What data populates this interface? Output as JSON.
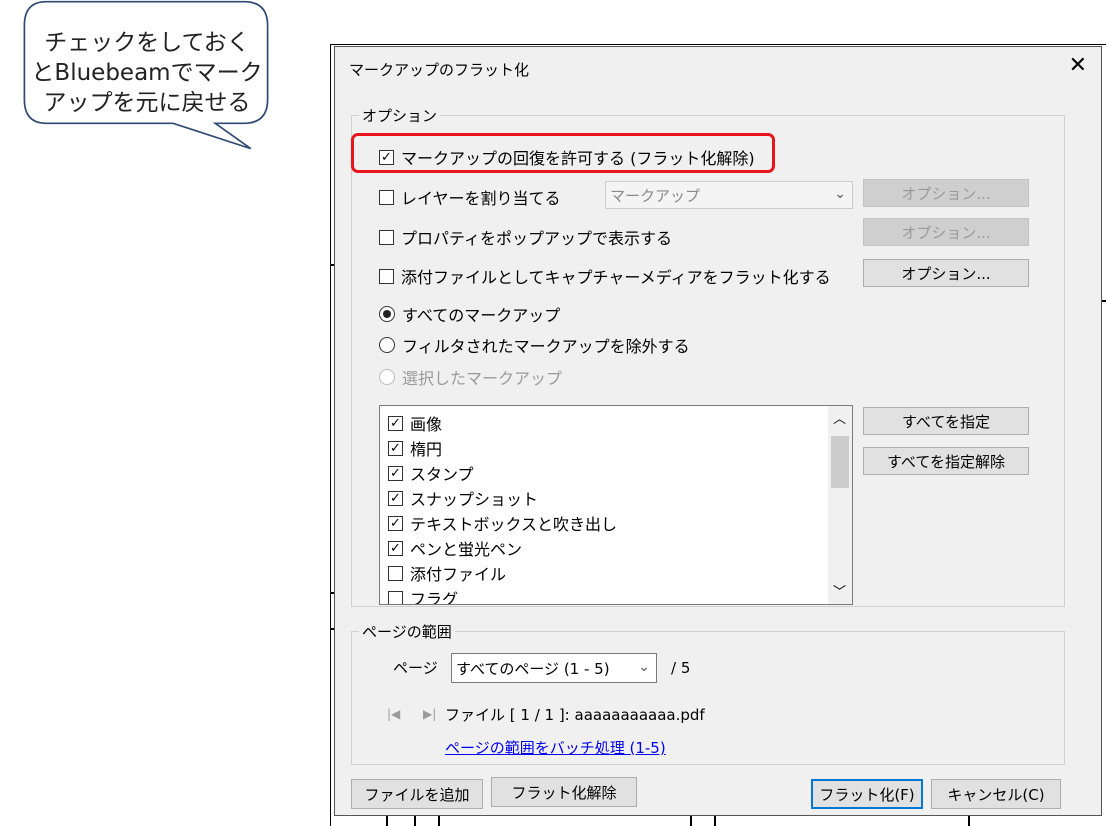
{
  "callout": {
    "lines": [
      "チェックをしておく",
      "とBluebeamでマーク",
      "アップを元に戻せる"
    ]
  },
  "dialog": {
    "title": "マークアップのフラット化",
    "options_legend": "オプション",
    "allow_restore": "マークアップの回復を許可する (フラット化解除)",
    "assign_layer": "レイヤーを割り当てる",
    "layer_select": "マークアップ",
    "properties_popup": "プロパティをポップアップで表示する",
    "attach_media": "添付ファイルとしてキャプチャーメディアをフラット化する",
    "option_button": "オプション...",
    "radio_all": "すべてのマークアップ",
    "radio_filtered": "フィルタされたマークアップを除外する",
    "radio_selected": "選択したマークアップ",
    "markup_types": [
      {
        "label": "画像",
        "checked": true
      },
      {
        "label": "楕円",
        "checked": true
      },
      {
        "label": "スタンプ",
        "checked": true
      },
      {
        "label": "スナップショット",
        "checked": true
      },
      {
        "label": "テキストボックスと吹き出し",
        "checked": true
      },
      {
        "label": "ペンと蛍光ペン",
        "checked": true
      },
      {
        "label": "添付ファイル",
        "checked": false
      },
      {
        "label": "フラグ",
        "checked": false
      }
    ],
    "select_all": "すべてを指定",
    "deselect_all": "すべてを指定解除",
    "page_range_legend": "ページの範囲",
    "page_label": "ページ",
    "page_select": "すべてのページ (1 - 5)",
    "page_total": "/  5",
    "file_nav_first": "|◀",
    "file_nav_next": "▶|",
    "file_info": "ファイル [ 1  /  1 ]:  aaaaaaaaaaa.pdf",
    "batch_link": "ページの範囲をバッチ処理 (1-5)",
    "add_file": "ファイルを追加",
    "unflatten": "フラット化解除",
    "flatten": "フラット化(F)",
    "cancel": "キャンセル(C)",
    "close_glyph": "✕",
    "check_glyph": "✓"
  }
}
